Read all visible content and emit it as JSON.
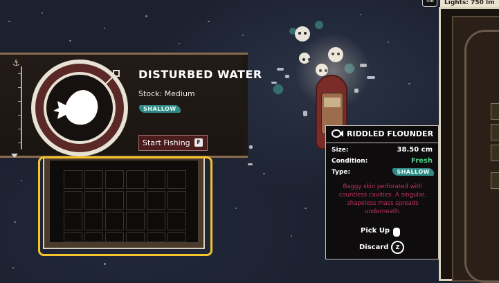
{
  "hud": {
    "tab_key": "TAB",
    "lights_label": "Lights: 750 lm"
  },
  "spot": {
    "title": "DISTURBED WATER",
    "stock": "Stock: Medium",
    "depth_badge": "SHALLOW",
    "start_button": "Start Fishing",
    "start_key": "F"
  },
  "inventory": {
    "rows": 4,
    "cols": 6
  },
  "tooltip": {
    "title": "RIDDLED FLOUNDER",
    "size_label": "Size:",
    "size_value": "38.50 cm",
    "condition_label": "Condition:",
    "condition_value": "Fresh",
    "type_label": "Type:",
    "type_value": "SHALLOW",
    "description": "Baggy skin perforated with countless cavities. A singular, shapeless mass spreads underneath.",
    "pickup_label": "Pick Up",
    "discard_label": "Discard",
    "discard_key": "Z"
  },
  "colors": {
    "highlight": "#f5c32a",
    "fresh": "#4cd08a",
    "shallow_badge": "#2f8a86",
    "description": "#c0306a"
  }
}
